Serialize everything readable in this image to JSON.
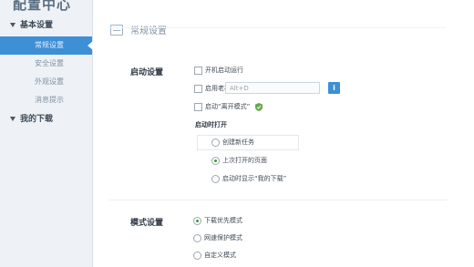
{
  "app": {
    "title": "配置中心"
  },
  "sidebar": {
    "groups": [
      {
        "label": "基本设置",
        "items": [
          {
            "label": "常规设置",
            "active": true
          },
          {
            "label": "安全设置",
            "active": false
          },
          {
            "label": "外观设置",
            "active": false
          },
          {
            "label": "消息提示",
            "active": false
          }
        ]
      },
      {
        "label": "我的下载",
        "items": []
      }
    ]
  },
  "main": {
    "header_title": "常规设置",
    "startup": {
      "label": "启动设置",
      "options": [
        {
          "label": "开机启动运行",
          "checked": false
        },
        {
          "label": "启用老板键",
          "checked": false
        },
        {
          "label": "启动“离开模式”",
          "checked": false
        }
      ],
      "hotkey_value": "Alt+D",
      "info_button": "i",
      "open_on_start_label": "启动时打开",
      "open_on_start_options": [
        {
          "label": "创建新任务",
          "checked": false
        },
        {
          "label": "上次打开的页面",
          "checked": true
        },
        {
          "label": "启动时显示“我的下载”",
          "checked": false
        }
      ]
    },
    "mode": {
      "label": "模式设置",
      "options": [
        {
          "label": "下载优先模式",
          "checked": true
        },
        {
          "label": "网速保护模式",
          "checked": false
        },
        {
          "label": "自定义模式",
          "checked": false
        }
      ]
    }
  },
  "colors": {
    "accent": "#3d8fd6",
    "sidebar_bg": "#eef2f6",
    "radio_checked": "#3a9a3a"
  }
}
